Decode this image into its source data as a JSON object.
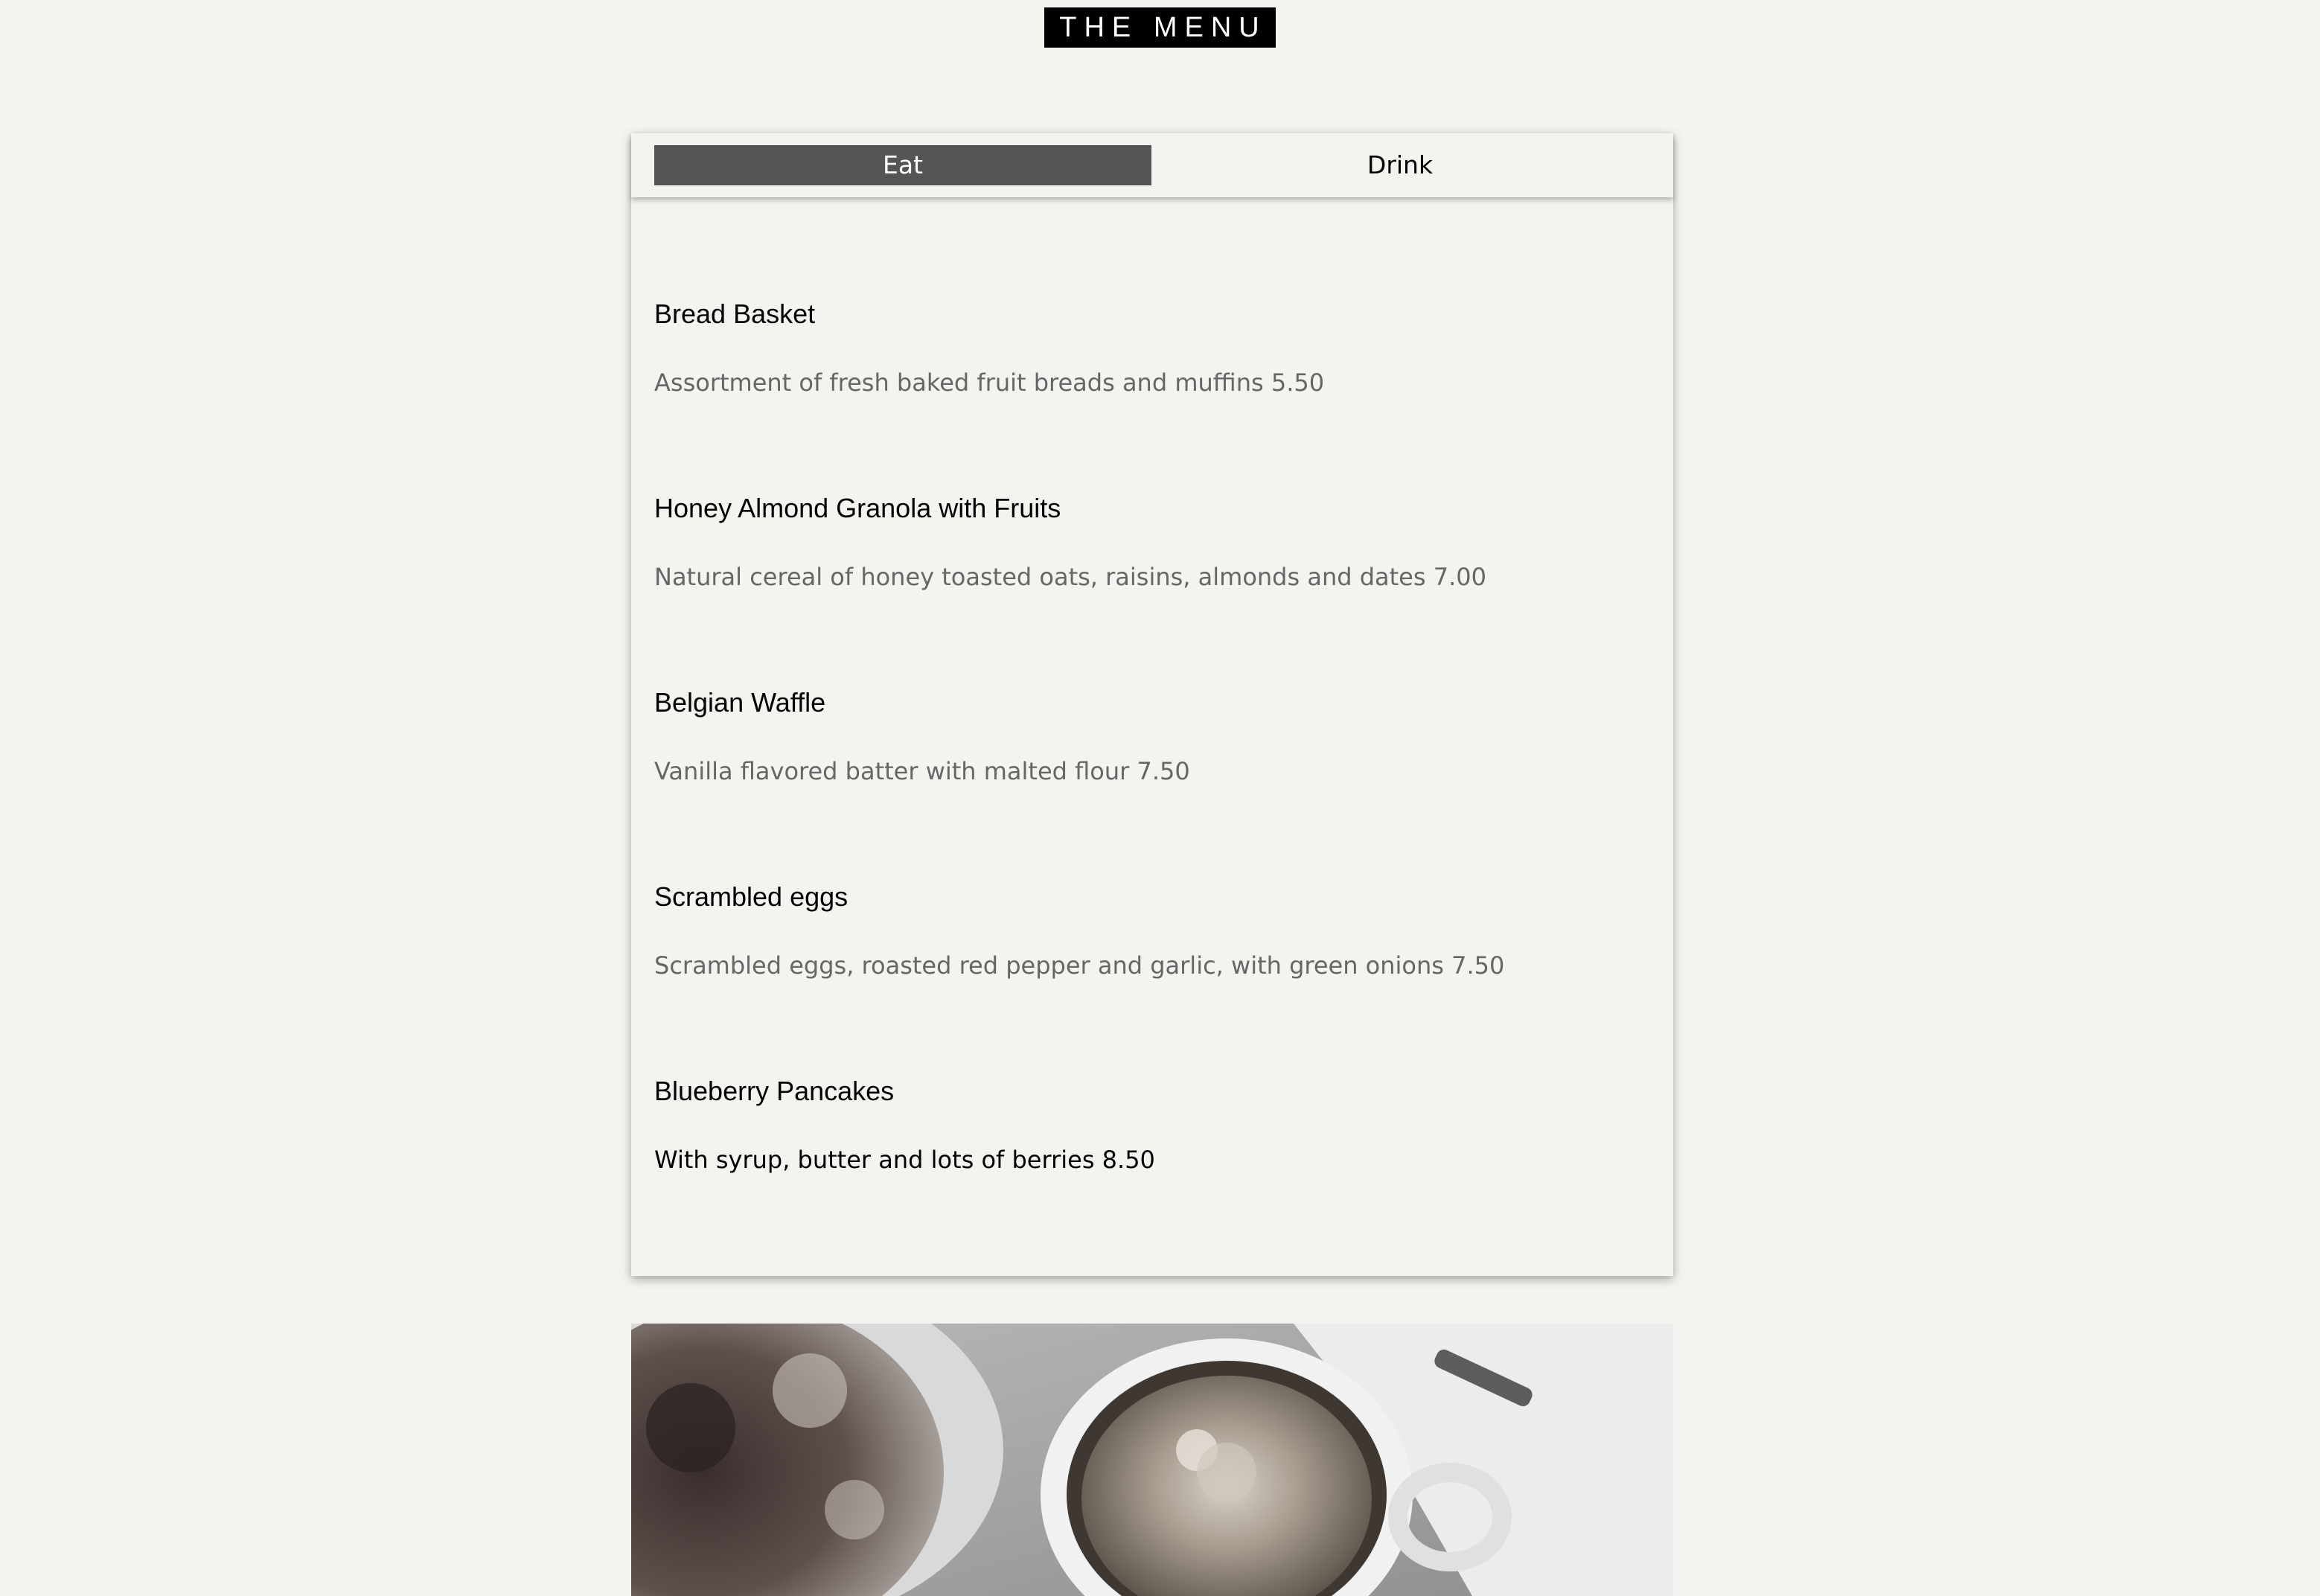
{
  "page": {
    "title": "THE MENU"
  },
  "tabs": [
    {
      "label": "Eat",
      "active": true
    },
    {
      "label": "Drink",
      "active": false
    }
  ],
  "items": [
    {
      "name": "Bread Basket",
      "description": "Assortment of fresh baked fruit breads and muffins 5.50"
    },
    {
      "name": "Honey Almond Granola with Fruits",
      "description": "Natural cereal of honey toasted oats, raisins, almonds and dates 7.00"
    },
    {
      "name": "Belgian Waffle",
      "description": "Vanilla flavored batter with malted flour 7.50"
    },
    {
      "name": "Scrambled eggs",
      "description": "Scrambled eggs, roasted red pepper and garlic, with green onions 7.50"
    },
    {
      "name": "Blueberry Pancakes",
      "description": "With syrup, butter and lots of berries 8.50"
    }
  ],
  "colors": {
    "background": "#f4f3ef",
    "active_tab": "#555555",
    "title_bg": "#000000",
    "description_text": "#666666"
  }
}
